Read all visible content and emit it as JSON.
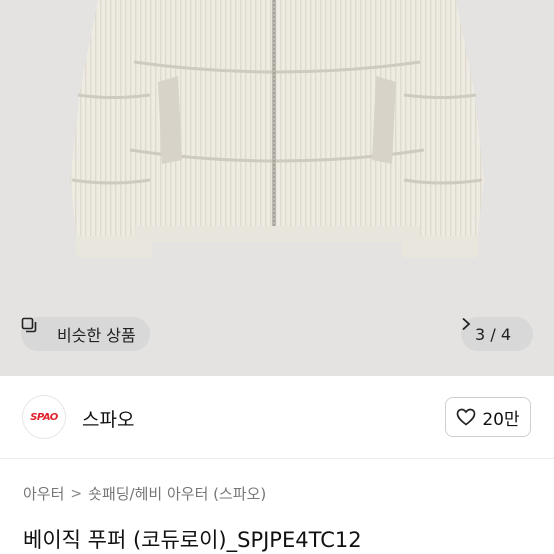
{
  "gallery": {
    "similar_label": "비슷한 상품",
    "similar_icon": "similar-items-icon",
    "pager_current": "3",
    "pager_sep": "/",
    "pager_total": "4",
    "next_icon": "chevron-right-icon"
  },
  "shop": {
    "logo_text": "SPAO",
    "logo_color": "#e0202b",
    "name": "스파오",
    "like_count": "20만",
    "like_icon": "heart-outline-icon"
  },
  "breadcrumb": {
    "level1": "아우터",
    "separator": ">",
    "level2": "숏패딩/헤비 아우터 (스파오)"
  },
  "product": {
    "title": "베이직 푸퍼 (코듀로이)_SPJPE4TC12"
  }
}
